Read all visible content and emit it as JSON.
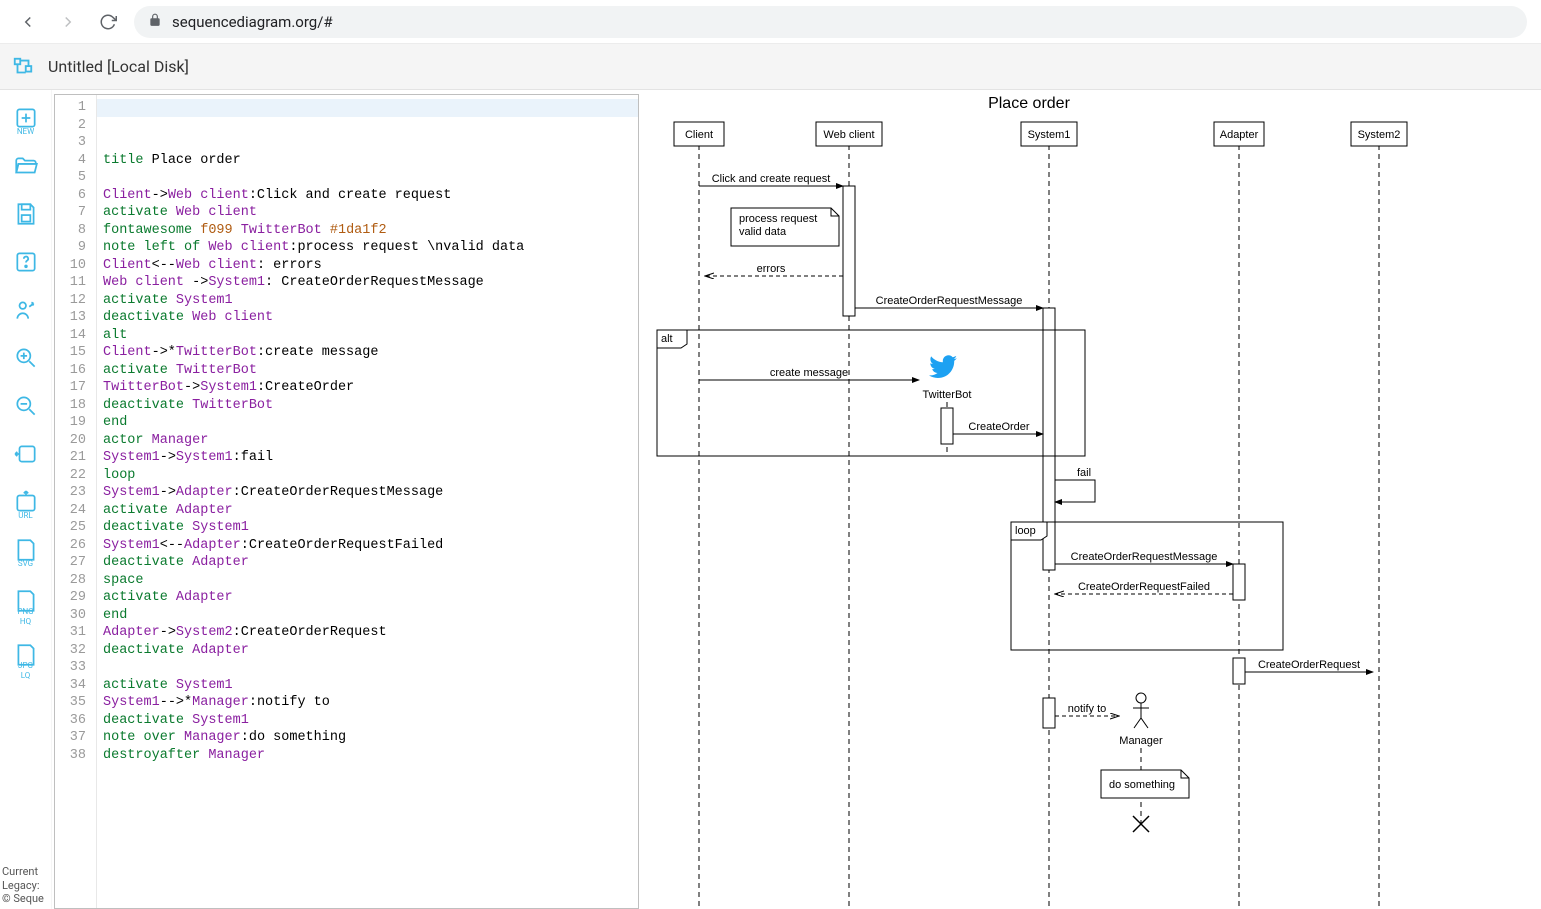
{
  "browser": {
    "url": "sequencediagram.org/#"
  },
  "header": {
    "title": "Untitled [Local Disk]"
  },
  "sidebar": {
    "new_cap": "NEW",
    "url_cap": "URL",
    "svg_cap": "SVG",
    "png_cap": "PNG",
    "png_sub": "HQ",
    "jpg_cap": "JPG",
    "jpg_sub": "LQ",
    "footer1": "Current",
    "footer2": "Legacy:",
    "footer3": "© Seque"
  },
  "editor": {
    "line_count": 38,
    "lines": [
      {
        "n": 1,
        "tokens": [
          {
            "t": "title",
            "c": "kw"
          },
          {
            "t": " Place order"
          }
        ]
      },
      {
        "n": 2,
        "tokens": []
      },
      {
        "n": 3,
        "tokens": [
          {
            "t": "Client",
            "c": "def"
          },
          {
            "t": "->"
          },
          {
            "t": "Web client",
            "c": "def"
          },
          {
            "t": ":Click and create request"
          }
        ]
      },
      {
        "n": 4,
        "tokens": [
          {
            "t": "activate",
            "c": "kw"
          },
          {
            "t": " "
          },
          {
            "t": "Web client",
            "c": "def"
          }
        ]
      },
      {
        "n": 5,
        "tokens": [
          {
            "t": "fontawesome",
            "c": "kw"
          },
          {
            "t": " "
          },
          {
            "t": "f099",
            "c": "num"
          },
          {
            "t": " "
          },
          {
            "t": "TwitterBot",
            "c": "def"
          },
          {
            "t": " "
          },
          {
            "t": "#1da1f2",
            "c": "hex"
          }
        ]
      },
      {
        "n": 6,
        "tokens": [
          {
            "t": "note left of",
            "c": "kw"
          },
          {
            "t": " "
          },
          {
            "t": "Web client",
            "c": "def"
          },
          {
            "t": ":process request \\nvalid data"
          }
        ]
      },
      {
        "n": 7,
        "tokens": [
          {
            "t": "Client",
            "c": "def"
          },
          {
            "t": "<--"
          },
          {
            "t": "Web client",
            "c": "def"
          },
          {
            "t": ": errors"
          }
        ]
      },
      {
        "n": 8,
        "tokens": [
          {
            "t": "Web client",
            "c": "def"
          },
          {
            "t": " ->"
          },
          {
            "t": "System1",
            "c": "def"
          },
          {
            "t": ": CreateOrderRequestMessage"
          }
        ]
      },
      {
        "n": 9,
        "tokens": [
          {
            "t": "activate",
            "c": "kw"
          },
          {
            "t": " "
          },
          {
            "t": "System1",
            "c": "def"
          }
        ]
      },
      {
        "n": 10,
        "tokens": [
          {
            "t": "deactivate",
            "c": "kw"
          },
          {
            "t": " "
          },
          {
            "t": "Web client",
            "c": "def"
          }
        ]
      },
      {
        "n": 11,
        "tokens": [
          {
            "t": "alt",
            "c": "kw"
          }
        ]
      },
      {
        "n": 12,
        "tokens": [
          {
            "t": "Client",
            "c": "def"
          },
          {
            "t": "->*"
          },
          {
            "t": "TwitterBot",
            "c": "def"
          },
          {
            "t": ":create message"
          }
        ]
      },
      {
        "n": 13,
        "tokens": [
          {
            "t": "activate",
            "c": "kw"
          },
          {
            "t": " "
          },
          {
            "t": "TwitterBot",
            "c": "def"
          }
        ]
      },
      {
        "n": 14,
        "tokens": [
          {
            "t": "TwitterBot",
            "c": "def"
          },
          {
            "t": "->"
          },
          {
            "t": "System1",
            "c": "def"
          },
          {
            "t": ":CreateOrder"
          }
        ]
      },
      {
        "n": 15,
        "tokens": [
          {
            "t": "deactivate",
            "c": "kw"
          },
          {
            "t": " "
          },
          {
            "t": "TwitterBot",
            "c": "def"
          }
        ]
      },
      {
        "n": 16,
        "tokens": [
          {
            "t": "end",
            "c": "kw"
          }
        ]
      },
      {
        "n": 17,
        "tokens": [
          {
            "t": "actor",
            "c": "kw"
          },
          {
            "t": " "
          },
          {
            "t": "Manager",
            "c": "def"
          }
        ]
      },
      {
        "n": 18,
        "tokens": [
          {
            "t": "System1",
            "c": "def"
          },
          {
            "t": "->"
          },
          {
            "t": "System1",
            "c": "def"
          },
          {
            "t": ":fail"
          }
        ]
      },
      {
        "n": 19,
        "tokens": [
          {
            "t": "loop",
            "c": "kw"
          }
        ]
      },
      {
        "n": 20,
        "tokens": [
          {
            "t": "System1",
            "c": "def"
          },
          {
            "t": "->"
          },
          {
            "t": "Adapter",
            "c": "def"
          },
          {
            "t": ":CreateOrderRequestMessage"
          }
        ]
      },
      {
        "n": 21,
        "tokens": [
          {
            "t": "activate",
            "c": "kw"
          },
          {
            "t": " "
          },
          {
            "t": "Adapter",
            "c": "def"
          }
        ]
      },
      {
        "n": 22,
        "tokens": [
          {
            "t": "deactivate",
            "c": "kw"
          },
          {
            "t": " "
          },
          {
            "t": "System1",
            "c": "def"
          }
        ]
      },
      {
        "n": 23,
        "tokens": [
          {
            "t": "System1",
            "c": "def"
          },
          {
            "t": "<--"
          },
          {
            "t": "Adapter",
            "c": "def"
          },
          {
            "t": ":CreateOrderRequestFailed"
          }
        ]
      },
      {
        "n": 24,
        "tokens": [
          {
            "t": "deactivate",
            "c": "kw"
          },
          {
            "t": " "
          },
          {
            "t": "Adapter",
            "c": "def"
          }
        ]
      },
      {
        "n": 25,
        "tokens": [
          {
            "t": "space",
            "c": "kw"
          }
        ]
      },
      {
        "n": 26,
        "tokens": [
          {
            "t": "activate",
            "c": "kw"
          },
          {
            "t": " "
          },
          {
            "t": "Adapter",
            "c": "def"
          }
        ]
      },
      {
        "n": 27,
        "tokens": [
          {
            "t": "end",
            "c": "kw"
          }
        ]
      },
      {
        "n": 28,
        "tokens": [
          {
            "t": "Adapter",
            "c": "def"
          },
          {
            "t": "->"
          },
          {
            "t": "System2",
            "c": "def"
          },
          {
            "t": ":CreateOrderRequest"
          }
        ]
      },
      {
        "n": 29,
        "tokens": [
          {
            "t": "deactivate",
            "c": "kw"
          },
          {
            "t": " "
          },
          {
            "t": "Adapter",
            "c": "def"
          }
        ]
      },
      {
        "n": 30,
        "tokens": []
      },
      {
        "n": 31,
        "tokens": [
          {
            "t": "activate",
            "c": "kw"
          },
          {
            "t": " "
          },
          {
            "t": "System1",
            "c": "def"
          }
        ]
      },
      {
        "n": 32,
        "tokens": [
          {
            "t": "System1",
            "c": "def"
          },
          {
            "t": "-->*"
          },
          {
            "t": "Manager",
            "c": "def"
          },
          {
            "t": ":notify to"
          }
        ]
      },
      {
        "n": 33,
        "tokens": [
          {
            "t": "deactivate",
            "c": "kw"
          },
          {
            "t": " "
          },
          {
            "t": "System1",
            "c": "def"
          }
        ]
      },
      {
        "n": 34,
        "tokens": [
          {
            "t": "note over",
            "c": "kw"
          },
          {
            "t": " "
          },
          {
            "t": "Manager",
            "c": "def"
          },
          {
            "t": ":do something"
          }
        ]
      },
      {
        "n": 35,
        "tokens": [
          {
            "t": "destroyafter",
            "c": "kw"
          },
          {
            "t": " "
          },
          {
            "t": "Manager",
            "c": "def"
          }
        ]
      },
      {
        "n": 36,
        "tokens": []
      },
      {
        "n": 37,
        "tokens": []
      },
      {
        "n": 38,
        "tokens": []
      }
    ]
  },
  "chart_data": {
    "type": "sequence-diagram",
    "title": "Place order",
    "participants": [
      "Client",
      "Web client",
      "System1",
      "Adapter",
      "System2",
      "TwitterBot",
      "Manager"
    ],
    "events": [
      {
        "from": "Client",
        "to": "Web client",
        "label": "Click and create request",
        "style": "solid"
      },
      {
        "note": "process request\nvalid data",
        "position": "left of",
        "target": "Web client"
      },
      {
        "from": "Web client",
        "to": "Client",
        "label": "errors",
        "style": "dashed"
      },
      {
        "from": "Web client",
        "to": "System1",
        "label": "CreateOrderRequestMessage",
        "style": "solid"
      },
      {
        "fragment": "alt",
        "contains": [
          {
            "from": "Client",
            "to": "TwitterBot",
            "label": "create message",
            "style": "solid",
            "create": true
          },
          {
            "from": "TwitterBot",
            "to": "System1",
            "label": "CreateOrder",
            "style": "solid"
          }
        ]
      },
      {
        "from": "System1",
        "to": "System1",
        "label": "fail",
        "style": "solid",
        "self": true
      },
      {
        "fragment": "loop",
        "contains": [
          {
            "from": "System1",
            "to": "Adapter",
            "label": "CreateOrderRequestMessage",
            "style": "solid"
          },
          {
            "from": "Adapter",
            "to": "System1",
            "label": "CreateOrderRequestFailed",
            "style": "dashed"
          }
        ]
      },
      {
        "from": "Adapter",
        "to": "System2",
        "label": "CreateOrderRequest",
        "style": "solid"
      },
      {
        "from": "System1",
        "to": "Manager",
        "label": "notify to",
        "style": "dashed",
        "create": true
      },
      {
        "note": "do something",
        "position": "over",
        "target": "Manager"
      },
      {
        "destroy": "Manager"
      }
    ]
  },
  "diagram_labels": {
    "title": "Place order",
    "p_client": "Client",
    "p_web": "Web client",
    "p_sys1": "System1",
    "p_adapter": "Adapter",
    "p_sys2": "System2",
    "p_twitter": "TwitterBot",
    "p_manager": "Manager",
    "m_click": "Click and create request",
    "m_note1a": "process request",
    "m_note1b": "valid data",
    "m_errors": "errors",
    "m_coreq": "CreateOrderRequestMessage",
    "m_alt": "alt",
    "m_createmsg": "create message",
    "m_createorder": "CreateOrder",
    "m_fail": "fail",
    "m_loop": "loop",
    "m_coreq2": "CreateOrderRequestMessage",
    "m_cofail": "CreateOrderRequestFailed",
    "m_coreq3": "CreateOrderRequest",
    "m_notify": "notify to",
    "m_dosomething": "do something"
  }
}
